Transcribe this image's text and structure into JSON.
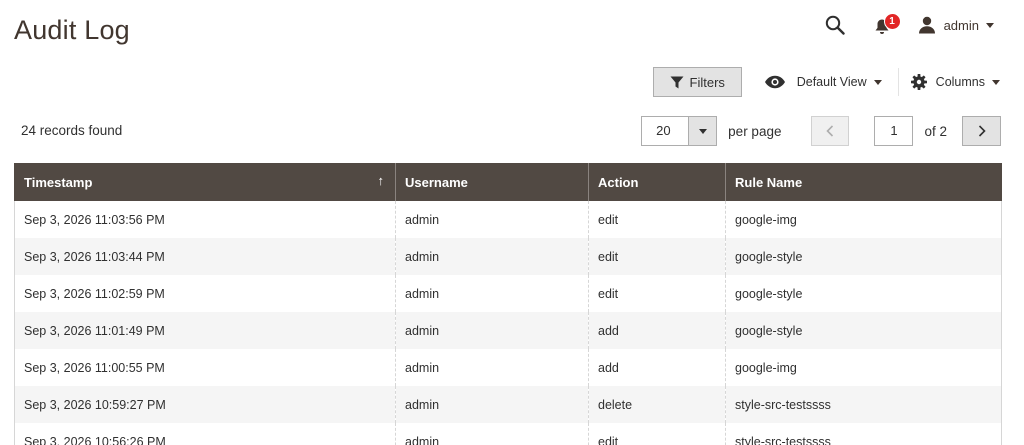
{
  "page": {
    "title": "Audit Log"
  },
  "header": {
    "notifications_count": "1",
    "user_label": "admin"
  },
  "toolbar": {
    "filters_label": "Filters",
    "view_label": "Default View",
    "columns_label": "Columns"
  },
  "records": {
    "count_text": "24 records found"
  },
  "pager": {
    "per_page_value": "20",
    "per_page_label": "per page",
    "current_page": "1",
    "of_text": "of 2"
  },
  "grid": {
    "columns": [
      "Timestamp",
      "Username",
      "Action",
      "Rule Name"
    ],
    "sort_indicator": "↑",
    "rows": [
      [
        "Sep 3, 2026 11:03:56 PM",
        "admin",
        "edit",
        "google-img"
      ],
      [
        "Sep 3, 2026 11:03:44 PM",
        "admin",
        "edit",
        "google-style"
      ],
      [
        "Sep 3, 2026 11:02:59 PM",
        "admin",
        "edit",
        "google-style"
      ],
      [
        "Sep 3, 2026 11:01:49 PM",
        "admin",
        "add",
        "google-style"
      ],
      [
        "Sep 3, 2026 11:00:55 PM",
        "admin",
        "add",
        "google-img"
      ],
      [
        "Sep 3, 2026 10:59:27 PM",
        "admin",
        "delete",
        "style-src-testssss"
      ],
      [
        "Sep 3, 2026 10:56:26 PM",
        "admin",
        "edit",
        "style-src-testssss"
      ]
    ]
  },
  "icons": {
    "search": "search-icon",
    "bell": "bell-icon",
    "user": "user-icon",
    "filter": "funnel-icon",
    "view": "eye-icon",
    "columns": "gear-icon",
    "prev": "chevron-left-icon",
    "next": "chevron-right-icon"
  },
  "colors": {
    "header_bg": "#514943",
    "badge": "#e22626",
    "title": "#41362f"
  }
}
